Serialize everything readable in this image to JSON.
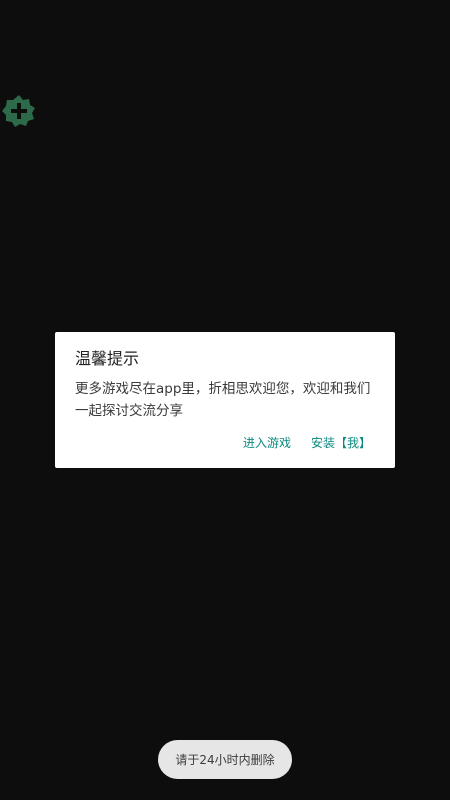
{
  "floating_icon": "plus-badge-icon",
  "colors": {
    "background": "#0e0d0e",
    "badge": "#2d6a4a",
    "accent": "#0b8a80"
  },
  "dialog": {
    "title": "温馨提示",
    "message": "更多游戏尽在app里，折相思欢迎您，欢迎和我们一起探讨交流分享",
    "buttons": {
      "enter_game": "进入游戏",
      "install": "安装【我】"
    }
  },
  "toast": {
    "text": "请于24小时内删除"
  }
}
